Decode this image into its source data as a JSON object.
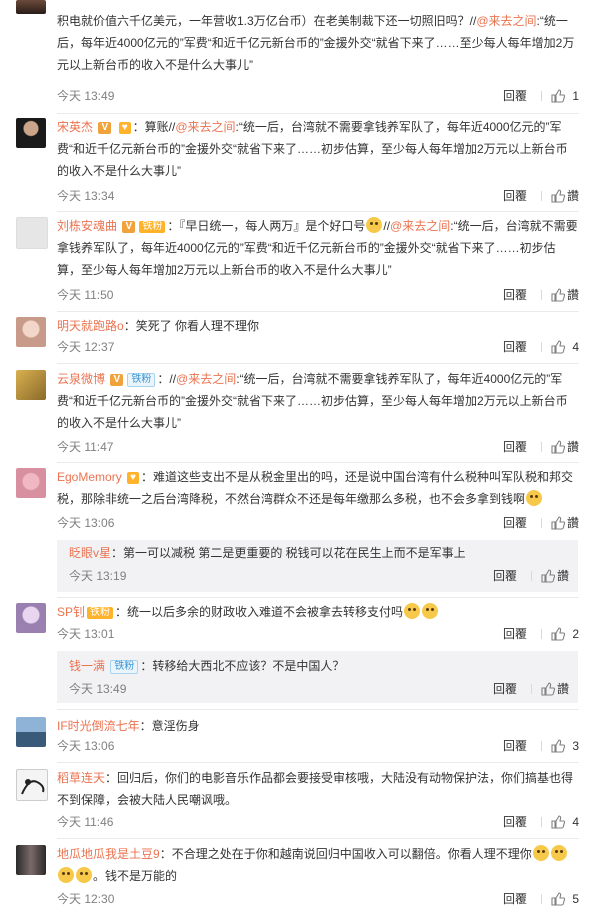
{
  "comments": [
    {
      "name": "",
      "text": "积电就价值六千亿美元，一年营收1.3万亿台币）在老美制裁下还一切照旧吗？//",
      "mention": "@来去之间",
      "text2": ":“统一后，每年近4000亿元的”军费“和近千亿元新台币的”金援外交“就省下来了……至少每人每年增加2万元以上新台币的收入不是什么大事儿”",
      "time": "今天 13:49",
      "reply": "回覆",
      "likes": "1"
    },
    {
      "name": "宋英杰",
      "badge_text": "V",
      "text": "：算账//",
      "mention": "@来去之间",
      "text2": ":“统一后，台湾就不需要拿钱养军队了，每年近4000亿元的”军费“和近千亿元新台币的”金援外交“就省下来了……初步估算，至少每人每年增加2万元以上新台币的收入不是什么大事儿”",
      "time": "今天 13:34",
      "reply": "回覆",
      "likes": "讚"
    },
    {
      "name": "刘栋安魂曲",
      "badge_text": "V",
      "badge2": "铁粉",
      "text": "：『早日统一，每人两万』是个好口号",
      "mention": "@来去之间",
      "text2": ":“统一后，台湾就不需要拿钱养军队了，每年近4000亿元的”军费“和近千亿元新台币的”金援外交“就省下来了……初步估算，至少每人每年增加2万元以上新台币的收入不是什么大事儿”",
      "time": "今天 11:50",
      "reply": "回覆",
      "likes": "讚"
    },
    {
      "name": "明天就跑路o",
      "text": "：笑死了 你看人理不理你",
      "time": "今天 12:37",
      "reply": "回覆",
      "likes": "4"
    },
    {
      "name": "云泉微博",
      "badge_text": "V",
      "badge2": "铁粉",
      "text": "：//",
      "mention": "@来去之间",
      "text2": ":“统一后，台湾就不需要拿钱养军队了，每年近4000亿元的”军费“和近千亿元新台币的”金援外交“就省下来了……初步估算，至少每人每年增加2万元以上新台币的收入不是什么大事儿”",
      "time": "今天 11:47",
      "reply": "回覆",
      "likes": "讚"
    },
    {
      "name": "EgoMemory",
      "text": "：难道这些支出不是从税金里出的吗，还是说中国台湾有什么税种叫军队税和邦交税，那除非统一之后台湾降税，不然台湾群众不还是每年缴那么多税，也不会多拿到钱啊",
      "time": "今天 13:06",
      "reply": "回覆",
      "likes": "讚",
      "sub": {
        "name": "眨眼v星",
        "text": "：第一可以减税 第二是更重要的 税钱可以花在民生上而不是军事上",
        "time": "今天 13:19",
        "reply": "回覆",
        "likes": "讚"
      }
    },
    {
      "name": "SP钊",
      "badge2": "铁粉",
      "text": "：统一以后多余的财政收入难道不会被拿去转移支付吗",
      "time": "今天 13:01",
      "reply": "回覆",
      "likes": "2",
      "sub": {
        "name": "钱一满",
        "badge2": "铁粉",
        "text": "：转移给大西北不应该？不是中国人？",
        "time": "今天 13:49",
        "reply": "回覆",
        "likes": "讚"
      }
    },
    {
      "name": "IF时光倒流七年",
      "text": "：意淫伤身",
      "time": "今天 13:06",
      "reply": "回覆",
      "likes": "3"
    },
    {
      "name": "稻草连天",
      "text": "：回归后，你们的电影音乐作品都会要接受审核哦，大陆没有动物保护法，你们搞基也得不到保障，会被大陆人民嘲讽哦。",
      "time": "今天 11:46",
      "reply": "回覆",
      "likes": "4"
    },
    {
      "name": "地瓜地瓜我是土豆9",
      "text": "：不合理之处在于你和越南说回归中国收入可以翻倍。你看人理不理你",
      "text2": "。钱不是万能的",
      "time": "今天 12:30",
      "reply": "回覆",
      "likes": "5"
    }
  ]
}
